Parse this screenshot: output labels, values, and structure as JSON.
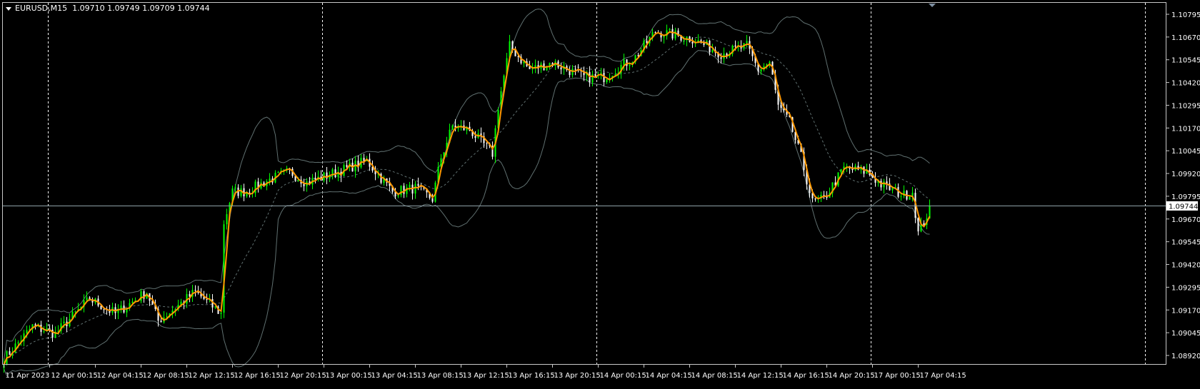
{
  "header": {
    "symbol": "EURUSD,M15",
    "ohlc": "1.09710 1.09749 1.09709 1.09744"
  },
  "colors": {
    "background": "#000000",
    "frame": "#c8c8c8",
    "bull": "#00ff00",
    "bear": "#ffffff",
    "ma": "#ff9900",
    "bands": "#607070",
    "grid": "#ffffff",
    "price_line": "#8fa0a8"
  },
  "chart_data": {
    "type": "candlestick",
    "title": "EURUSD,M15",
    "timeframe_minutes": 15,
    "ylim": [
      1.0892,
      1.10795
    ],
    "yticks": [
      "1.10795",
      "1.10670",
      "1.10545",
      "1.10420",
      "1.10295",
      "1.10170",
      "1.10045",
      "1.09920",
      "1.09795",
      "1.09670",
      "1.09545",
      "1.09420",
      "1.09295",
      "1.09170",
      "1.09045",
      "1.08920"
    ],
    "current_price": "1.09744",
    "xticks": [
      {
        "bar": 0,
        "label": "11 Apr 2023"
      },
      {
        "bar": 16,
        "label": "12 Apr 00:15"
      },
      {
        "bar": 32,
        "label": "12 Apr 04:15"
      },
      {
        "bar": 48,
        "label": "12 Apr 08:15"
      },
      {
        "bar": 64,
        "label": "12 Apr 12:15"
      },
      {
        "bar": 80,
        "label": "12 Apr 16:15"
      },
      {
        "bar": 96,
        "label": "12 Apr 20:15"
      },
      {
        "bar": 112,
        "label": "13 Apr 00:15"
      },
      {
        "bar": 128,
        "label": "13 Apr 04:15"
      },
      {
        "bar": 144,
        "label": "13 Apr 08:15"
      },
      {
        "bar": 160,
        "label": "13 Apr 12:15"
      },
      {
        "bar": 176,
        "label": "13 Apr 16:15"
      },
      {
        "bar": 192,
        "label": "13 Apr 20:15"
      },
      {
        "bar": 208,
        "label": "14 Apr 00:15"
      },
      {
        "bar": 224,
        "label": "14 Apr 04:15"
      },
      {
        "bar": 240,
        "label": "14 Apr 08:15"
      },
      {
        "bar": 256,
        "label": "14 Apr 12:15"
      },
      {
        "bar": 272,
        "label": "14 Apr 16:15"
      },
      {
        "bar": 288,
        "label": "14 Apr 20:15"
      },
      {
        "bar": 304,
        "label": "17 Apr 00:15"
      },
      {
        "bar": 320,
        "label": "17 Apr 04:15"
      }
    ],
    "day_separators": [
      15.5,
      111.5,
      207.5,
      303.5,
      399.5
    ],
    "close_keypoints": [
      [
        0,
        1.089
      ],
      [
        10,
        1.0908
      ],
      [
        18,
        1.0904
      ],
      [
        30,
        1.0923
      ],
      [
        39,
        1.0915
      ],
      [
        50,
        1.0927
      ],
      [
        54,
        1.0911
      ],
      [
        67,
        1.0927
      ],
      [
        76,
        1.0915
      ],
      [
        77,
        1.0965
      ],
      [
        80,
        1.0982
      ],
      [
        85,
        1.0982
      ],
      [
        92,
        1.0988
      ],
      [
        100,
        1.0993
      ],
      [
        106,
        1.0987
      ],
      [
        117,
        1.0993
      ],
      [
        127,
        1.0999
      ],
      [
        136,
        1.0982
      ],
      [
        144,
        1.0984
      ],
      [
        150,
        1.0978
      ],
      [
        153,
        1.1001
      ],
      [
        157,
        1.1018
      ],
      [
        163,
        1.1016
      ],
      [
        171,
        1.1003
      ],
      [
        173,
        1.1029
      ],
      [
        177,
        1.1062
      ],
      [
        184,
        1.1049
      ],
      [
        192,
        1.1053
      ],
      [
        203,
        1.1045
      ],
      [
        210,
        1.1045
      ],
      [
        221,
        1.1056
      ],
      [
        228,
        1.107
      ],
      [
        235,
        1.1068
      ],
      [
        241,
        1.1066
      ],
      [
        251,
        1.1058
      ],
      [
        260,
        1.1062
      ],
      [
        264,
        1.1049
      ],
      [
        268,
        1.1053
      ],
      [
        271,
        1.1029
      ],
      [
        275,
        1.102
      ],
      [
        279,
        1.1001
      ],
      [
        283,
        1.0976
      ],
      [
        287,
        1.0978
      ],
      [
        294,
        1.0995
      ],
      [
        302,
        1.0993
      ],
      [
        307,
        1.0986
      ],
      [
        315,
        1.098
      ],
      [
        318,
        1.0982
      ],
      [
        320,
        1.0959
      ],
      [
        323,
        1.0969
      ],
      [
        324,
        1.09744
      ]
    ],
    "indicators": [
      {
        "name": "Moving Average",
        "period": 3
      },
      {
        "name": "Bollinger Bands",
        "period": 20,
        "deviation": 2
      }
    ]
  }
}
